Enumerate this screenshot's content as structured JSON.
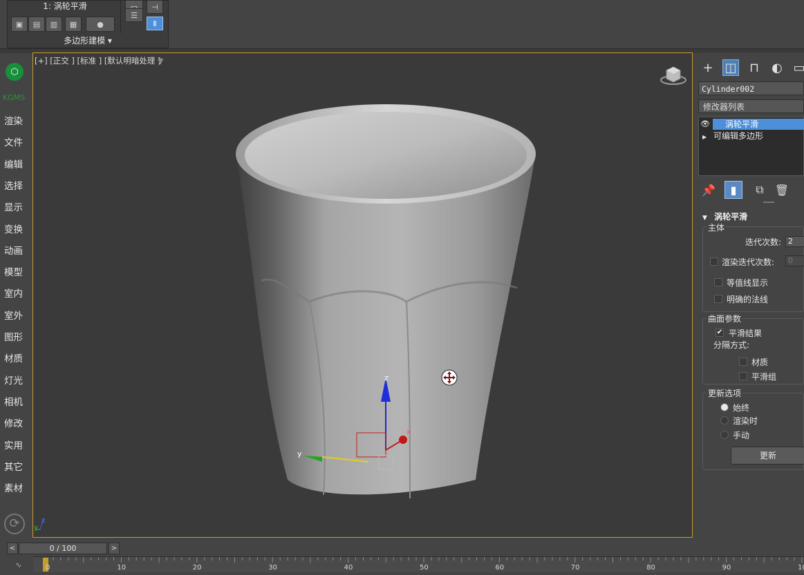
{
  "ribbon": {
    "title": "1: 涡轮平滑",
    "footer": "多边形建模",
    "dropdown_arrow": "▾"
  },
  "sidebar": {
    "brand": "KGMS",
    "items": [
      "渲染",
      "文件",
      "编辑",
      "选择",
      "显示",
      "变换",
      "动画",
      "模型",
      "室内",
      "室外",
      "图形",
      "材质",
      "灯光",
      "相机",
      "修改",
      "实用",
      "其它",
      "素材"
    ]
  },
  "viewport": {
    "label": "[+] [正交 ] [标准 ] [默认明暗处理 ]",
    "border_color": "#c89b2e",
    "gizmo": {
      "z": "z",
      "x": "x",
      "y": "y"
    },
    "corner_axes": {
      "z": "z",
      "y": "y"
    }
  },
  "command_panel": {
    "tabs": [
      "create-icon",
      "modify-icon",
      "hierarchy-icon",
      "motion-icon",
      "display-icon"
    ],
    "object_name": "Cylinder002",
    "modifier_list": "修改器列表",
    "stack": [
      {
        "label": "涡轮平滑",
        "selected": true
      },
      {
        "label": "可编辑多边形",
        "selected": false
      }
    ],
    "rollout": {
      "title": "涡轮平滑",
      "main_group": "主体",
      "iterations_label": "迭代次数:",
      "iterations_value": "2",
      "render_iters_label": "渲染迭代次数:",
      "render_iters_value": "0",
      "isoline_label": "等值线显示",
      "explicit_normals_label": "明确的法线",
      "surface_group": "曲面参数",
      "smooth_result_label": "平滑结果",
      "smooth_result_checked": true,
      "separate_label": "分隔方式:",
      "material_label": "材质",
      "smooth_group_label": "平滑组",
      "update_group": "更新选项",
      "always_label": "始终",
      "when_render_label": "渲染时",
      "manual_label": "手动",
      "update_button": "更新"
    }
  },
  "timeline": {
    "frame_display": "0 / 100",
    "ticks": [
      "0",
      "10",
      "20",
      "30",
      "40",
      "50",
      "60",
      "70",
      "80",
      "90",
      "10"
    ],
    "prev_label": "<",
    "next_label": ">"
  },
  "accent_color": "#4d8fd9"
}
